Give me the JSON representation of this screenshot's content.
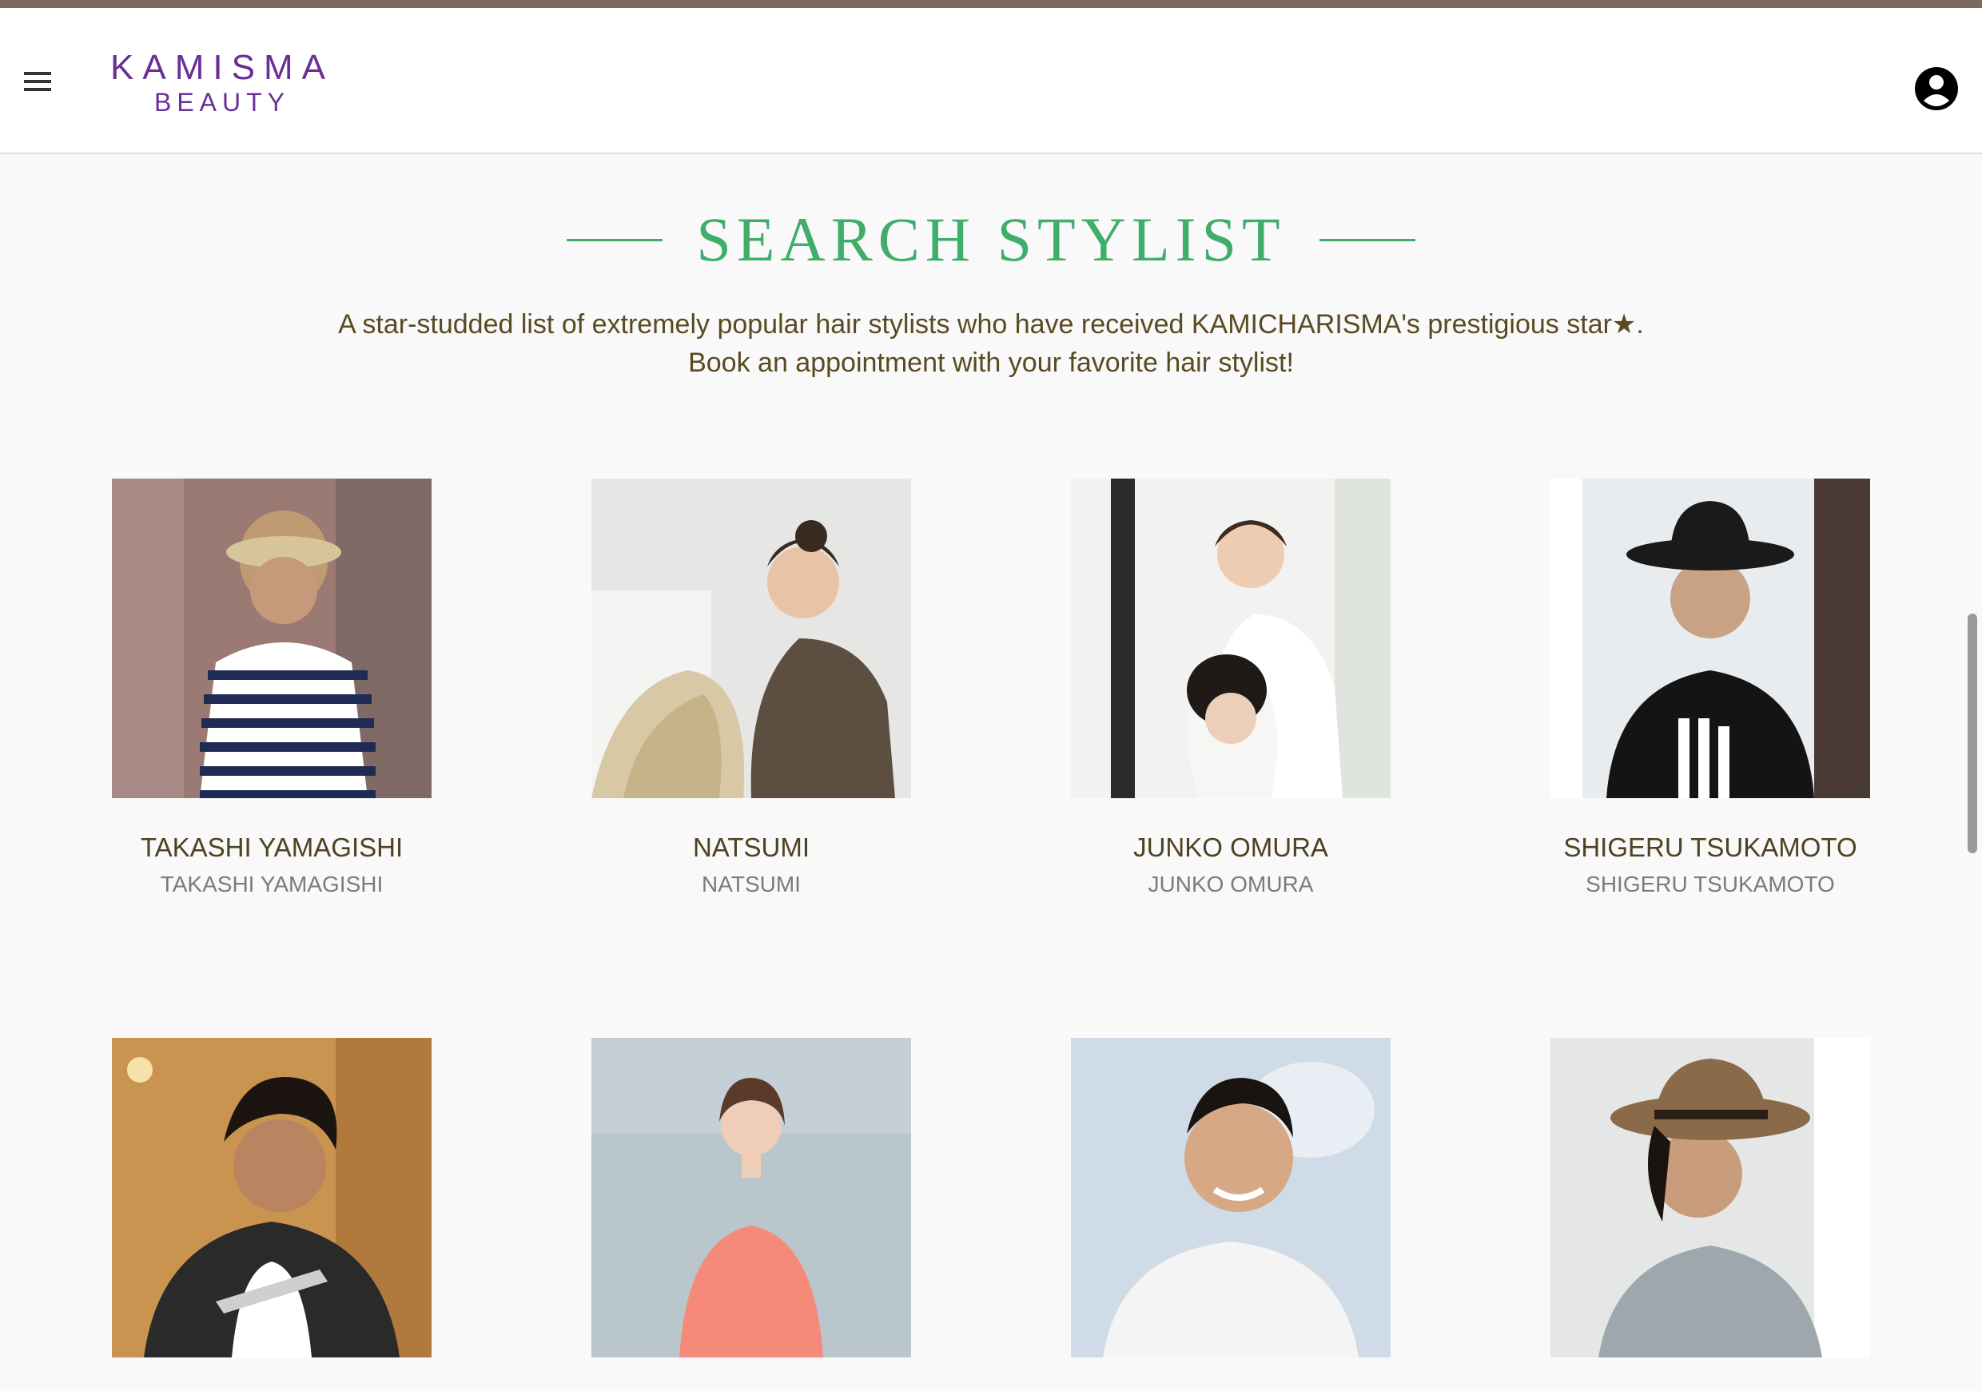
{
  "header": {
    "logo_line1": "KAMISMA",
    "logo_line2": "BEAUTY",
    "menu_icon": "hamburger-menu-icon",
    "account_icon": "account-circle-icon"
  },
  "main": {
    "title": "SEARCH STYLIST",
    "description_line1": "A star-studded list of extremely popular hair stylists who have received KAMICHARISMA's prestigious star★.",
    "description_line2": "Book an appointment with your favorite hair stylist!"
  },
  "stylists": [
    {
      "name": "TAKASHI YAMAGISHI",
      "subname": "TAKASHI YAMAGISHI"
    },
    {
      "name": "NATSUMI",
      "subname": "NATSUMI"
    },
    {
      "name": "JUNKO OMURA",
      "subname": "JUNKO OMURA"
    },
    {
      "name": "SHIGERU TSUKAMOTO",
      "subname": "SHIGERU TSUKAMOTO"
    },
    {
      "name": "",
      "subname": ""
    },
    {
      "name": "",
      "subname": ""
    },
    {
      "name": "",
      "subname": ""
    },
    {
      "name": "",
      "subname": ""
    }
  ],
  "colors": {
    "brand_purple": "#6a2f96",
    "accent_green": "#3fae6a",
    "top_bar": "#7b6a5d",
    "text_brown": "#5a4a22"
  }
}
